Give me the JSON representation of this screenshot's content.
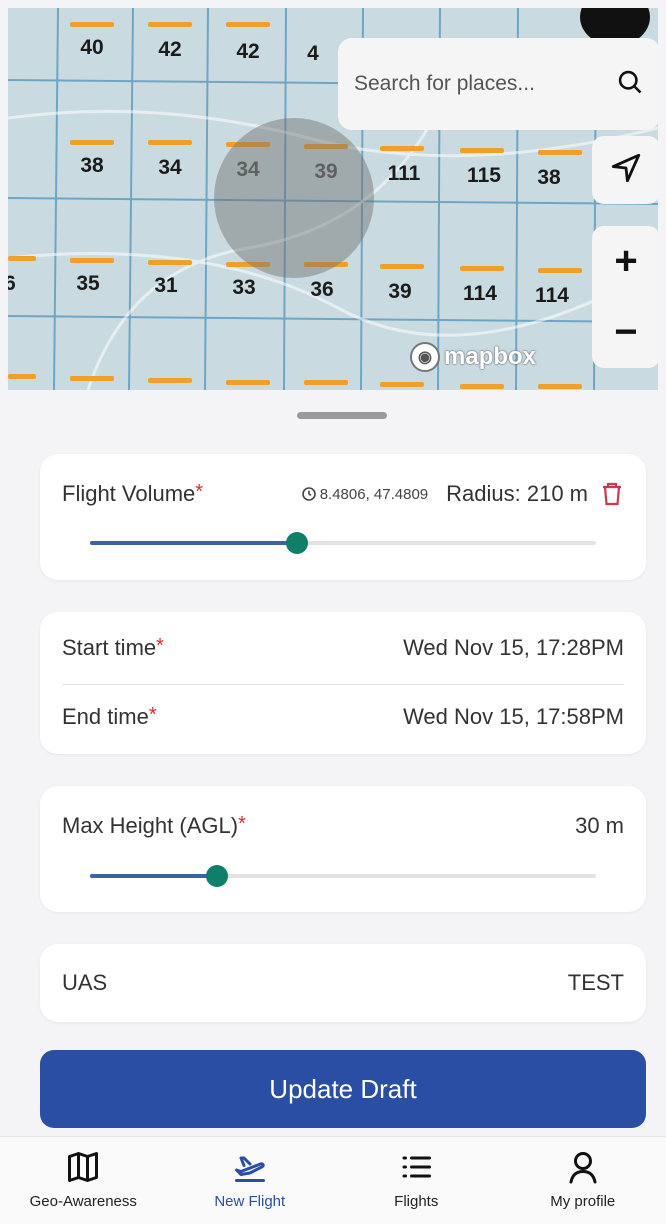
{
  "map": {
    "search_placeholder": "Search for places...",
    "attribution": "mapbox",
    "zoom_in_label": "+",
    "zoom_out_label": "−",
    "cells": [
      {
        "text": "40"
      },
      {
        "text": "42"
      },
      {
        "text": "42"
      },
      {
        "text": "4"
      },
      {
        "text": "38"
      },
      {
        "text": "34"
      },
      {
        "text": "34"
      },
      {
        "text": "39"
      },
      {
        "text": "111"
      },
      {
        "text": "115"
      },
      {
        "text": "38"
      },
      {
        "text": "6"
      },
      {
        "text": "35"
      },
      {
        "text": "31"
      },
      {
        "text": "33"
      },
      {
        "text": "36"
      },
      {
        "text": "39"
      },
      {
        "text": "114"
      },
      {
        "text": "114"
      }
    ]
  },
  "flight_volume": {
    "label": "Flight Volume",
    "required_mark": "*",
    "coordinates": "8.4806, 47.4809",
    "radius": "Radius: 210 m",
    "slider_fraction": 0.41
  },
  "times": {
    "start_label": "Start time",
    "start_value": "Wed Nov 15, 17:28PM",
    "end_label": "End time",
    "end_value": "Wed Nov 15, 17:58PM",
    "required_mark": "*"
  },
  "max_height": {
    "label": "Max Height (AGL)",
    "required_mark": "*",
    "value": "30 m",
    "slider_fraction": 0.25
  },
  "uas": {
    "label": "UAS",
    "value": "TEST"
  },
  "actions": {
    "update_label": "Update Draft"
  },
  "nav": {
    "items": [
      {
        "label": "Geo-Awareness",
        "icon": "map-icon",
        "active": false
      },
      {
        "label": "New Flight",
        "icon": "plane-icon",
        "active": true
      },
      {
        "label": "Flights",
        "icon": "list-icon",
        "active": false
      },
      {
        "label": "My profile",
        "icon": "person-icon",
        "active": false
      }
    ]
  },
  "colors": {
    "accent": "#2a4ea3",
    "slider_thumb": "#0f7f6a",
    "required": "#d32f2f",
    "delete_icon": "#d0364f"
  }
}
